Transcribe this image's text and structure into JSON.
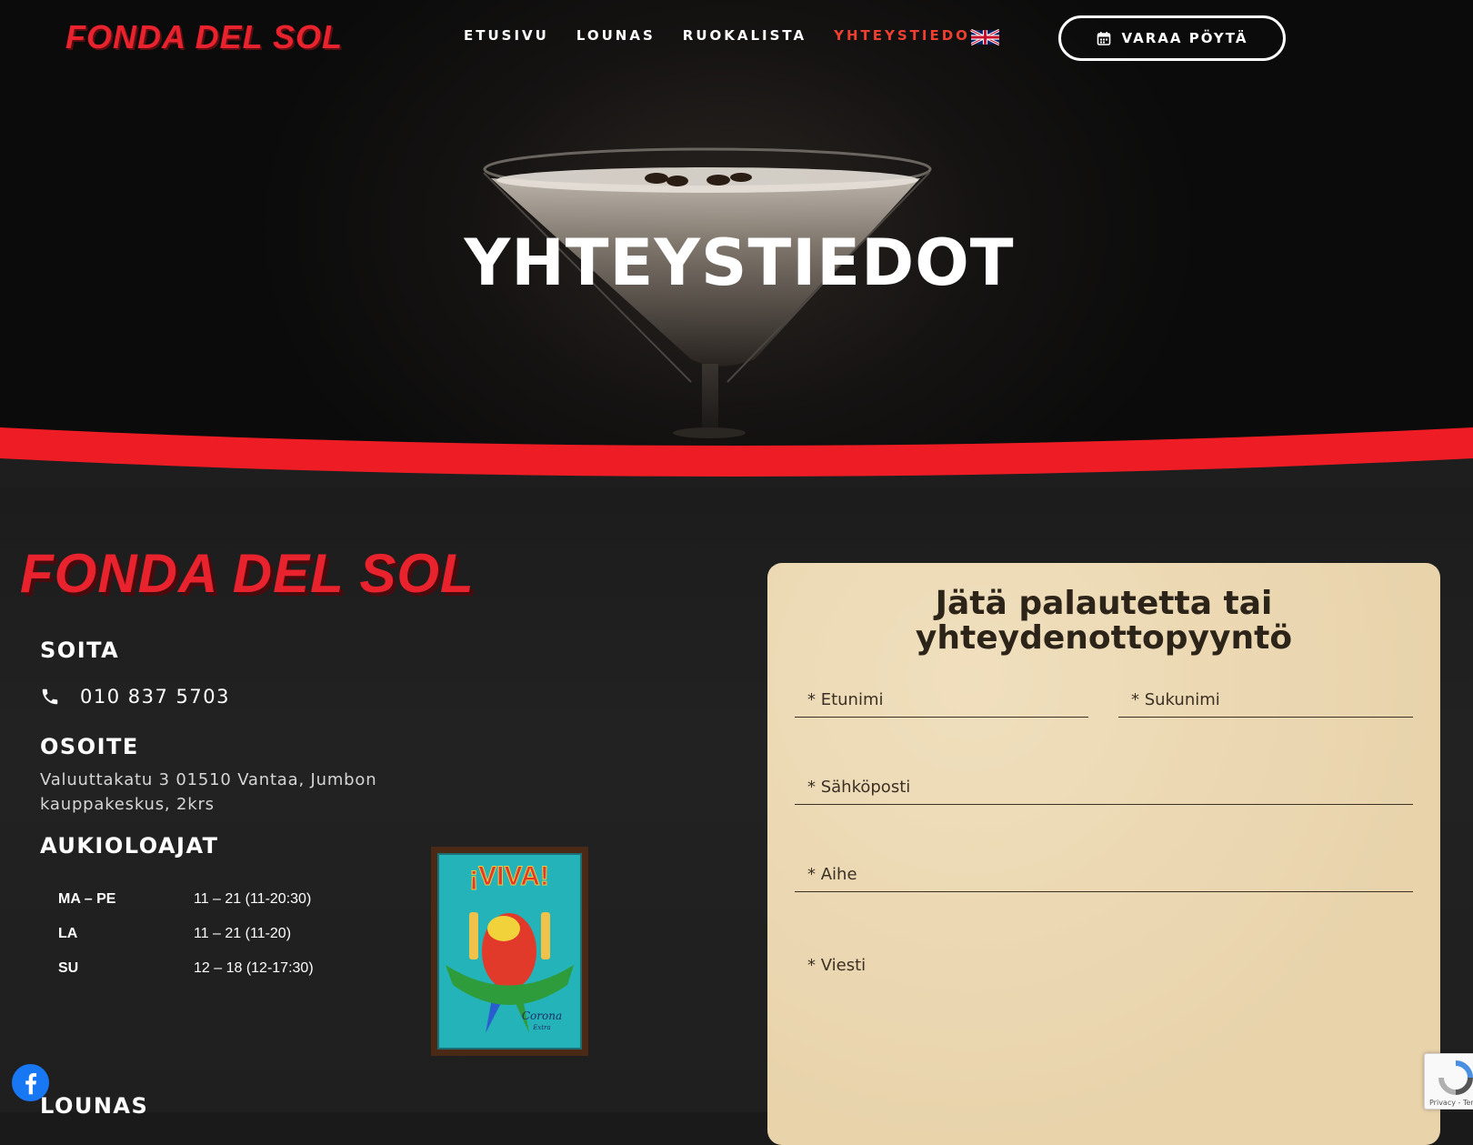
{
  "brand": {
    "logo": "FONDA DEL SOL",
    "accent_color": "#e8232d"
  },
  "nav": {
    "items": [
      {
        "label": "ETUSIVU",
        "active": false
      },
      {
        "label": "LOUNAS",
        "active": false
      },
      {
        "label": "RUOKALISTA",
        "active": false
      },
      {
        "label": "YHTEYSTIEDOT",
        "active": true
      }
    ],
    "language_icon": "uk-flag-icon",
    "book_button": "VARAA PÖYTÄ",
    "book_icon": "calendar-icon"
  },
  "hero": {
    "title": "YHTEYSTIEDOT"
  },
  "contact": {
    "logo": "FONDA DEL SOL",
    "call_heading": "SOITA",
    "phone": "010 837 5703",
    "address_heading": "OSOITE",
    "address": "Valuuttakatu 3 01510 Vantaa, Jumbon kauppakeskus, 2krs",
    "hours_heading": "AUKIOLOAJAT",
    "hours": [
      {
        "day": "MA – PE",
        "time": "11 – 21 (11-20:30)"
      },
      {
        "day": "LA",
        "time": "11 – 21 (11-20)"
      },
      {
        "day": "SU",
        "time": "12 – 18 (12-17:30)"
      }
    ],
    "lunch_heading": "LOUNAS",
    "poster_text": "¡VIVA!",
    "poster_brand": "Corona",
    "poster_brand_sub": "Extra"
  },
  "form": {
    "title_line1": "Jätä palautetta tai",
    "title_line2": "yhteydenottopyyntö",
    "first_name": "* Etunimi",
    "last_name": "* Sukunimi",
    "email": "* Sähköposti",
    "subject": "* Aihe",
    "message": "* Viesti"
  },
  "recaptcha": {
    "text": "Privacy - Terms"
  },
  "social": {
    "icon": "facebook-icon"
  }
}
